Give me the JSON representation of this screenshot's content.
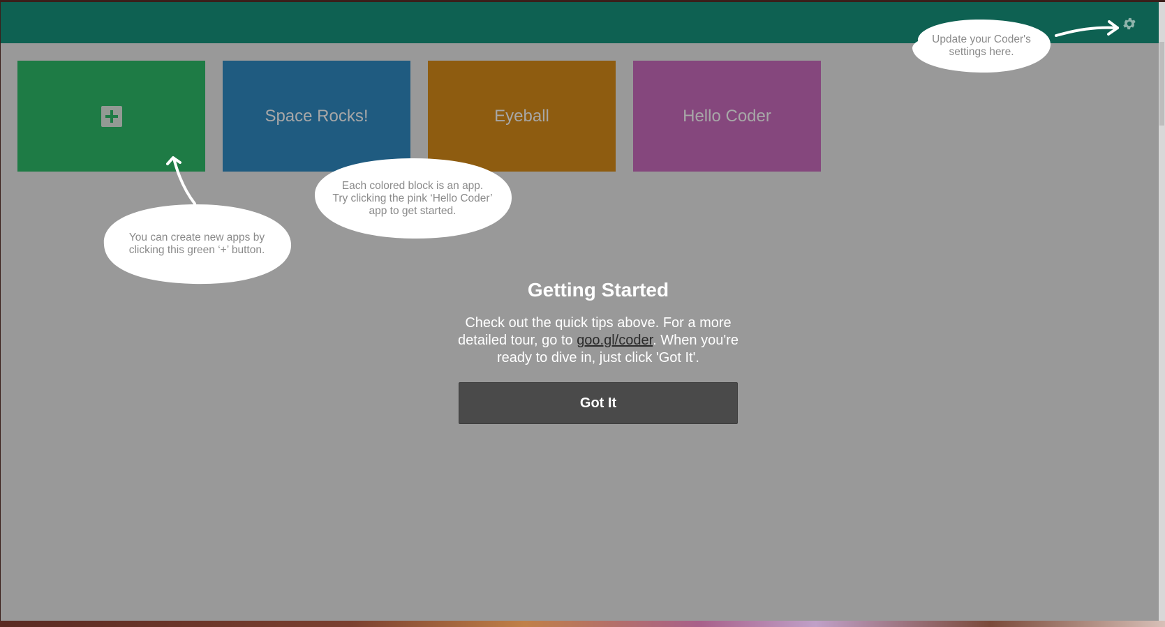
{
  "tiles": [
    {
      "label": "",
      "icon": "plus-icon",
      "color": "#1e7b45"
    },
    {
      "label": "Space Rocks!",
      "color": "#1f5b80"
    },
    {
      "label": "Eyeball",
      "color": "#8e5c10"
    },
    {
      "label": "Hello Coder",
      "color": "#85477d"
    }
  ],
  "topbar": {
    "color": "#0e6152",
    "settings_icon": "gear-icon"
  },
  "tips": {
    "settings": "Update your Coder's\nsettings here.",
    "apps": "Each colored block is an app.\nTry clicking the pink ‘Hello Coder’\napp to get started.",
    "create": "You can create new apps by\nclicking this green ‘+’ button."
  },
  "getting_started": {
    "title": "Getting Started",
    "body_before": "Check out the quick tips above. For a more detailed tour, go to ",
    "link": "goo.gl/coder",
    "body_after": ". When you're ready to dive in, just click 'Got It'.",
    "button": "Got It"
  }
}
